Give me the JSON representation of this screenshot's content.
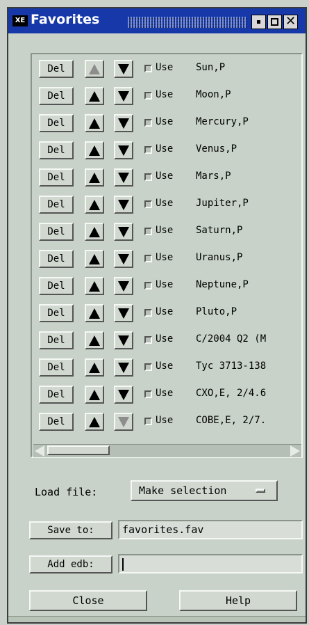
{
  "window": {
    "title": "Favorites",
    "icon_label": "XE",
    "close_glyph": "✕"
  },
  "rows": [
    {
      "del": "Del",
      "use": "Use",
      "name": "Sun,P",
      "up_disabled": true,
      "down_disabled": false
    },
    {
      "del": "Del",
      "use": "Use",
      "name": "Moon,P",
      "up_disabled": false,
      "down_disabled": false
    },
    {
      "del": "Del",
      "use": "Use",
      "name": "Mercury,P",
      "up_disabled": false,
      "down_disabled": false
    },
    {
      "del": "Del",
      "use": "Use",
      "name": "Venus,P",
      "up_disabled": false,
      "down_disabled": false
    },
    {
      "del": "Del",
      "use": "Use",
      "name": "Mars,P",
      "up_disabled": false,
      "down_disabled": false
    },
    {
      "del": "Del",
      "use": "Use",
      "name": "Jupiter,P",
      "up_disabled": false,
      "down_disabled": false
    },
    {
      "del": "Del",
      "use": "Use",
      "name": "Saturn,P",
      "up_disabled": false,
      "down_disabled": false
    },
    {
      "del": "Del",
      "use": "Use",
      "name": "Uranus,P",
      "up_disabled": false,
      "down_disabled": false
    },
    {
      "del": "Del",
      "use": "Use",
      "name": "Neptune,P",
      "up_disabled": false,
      "down_disabled": false
    },
    {
      "del": "Del",
      "use": "Use",
      "name": "Pluto,P",
      "up_disabled": false,
      "down_disabled": false
    },
    {
      "del": "Del",
      "use": "Use",
      "name": "C/2004 Q2 (M",
      "up_disabled": false,
      "down_disabled": false
    },
    {
      "del": "Del",
      "use": "Use",
      "name": "Tyc 3713-138",
      "up_disabled": false,
      "down_disabled": false
    },
    {
      "del": "Del",
      "use": "Use",
      "name": "CXO,E, 2/4.6",
      "up_disabled": false,
      "down_disabled": false
    },
    {
      "del": "Del",
      "use": "Use",
      "name": "COBE,E, 2/7.",
      "up_disabled": false,
      "down_disabled": true
    }
  ],
  "controls": {
    "load_label": "Load file:",
    "load_selection": "Make selection",
    "save_label": "Save to:",
    "save_value": "favorites.fav",
    "add_label": "Add edb:",
    "add_value": "",
    "close_label": "Close",
    "help_label": "Help"
  },
  "colors": {
    "titlebar": "#1638a8",
    "window_bg": "#c8d2c8"
  }
}
